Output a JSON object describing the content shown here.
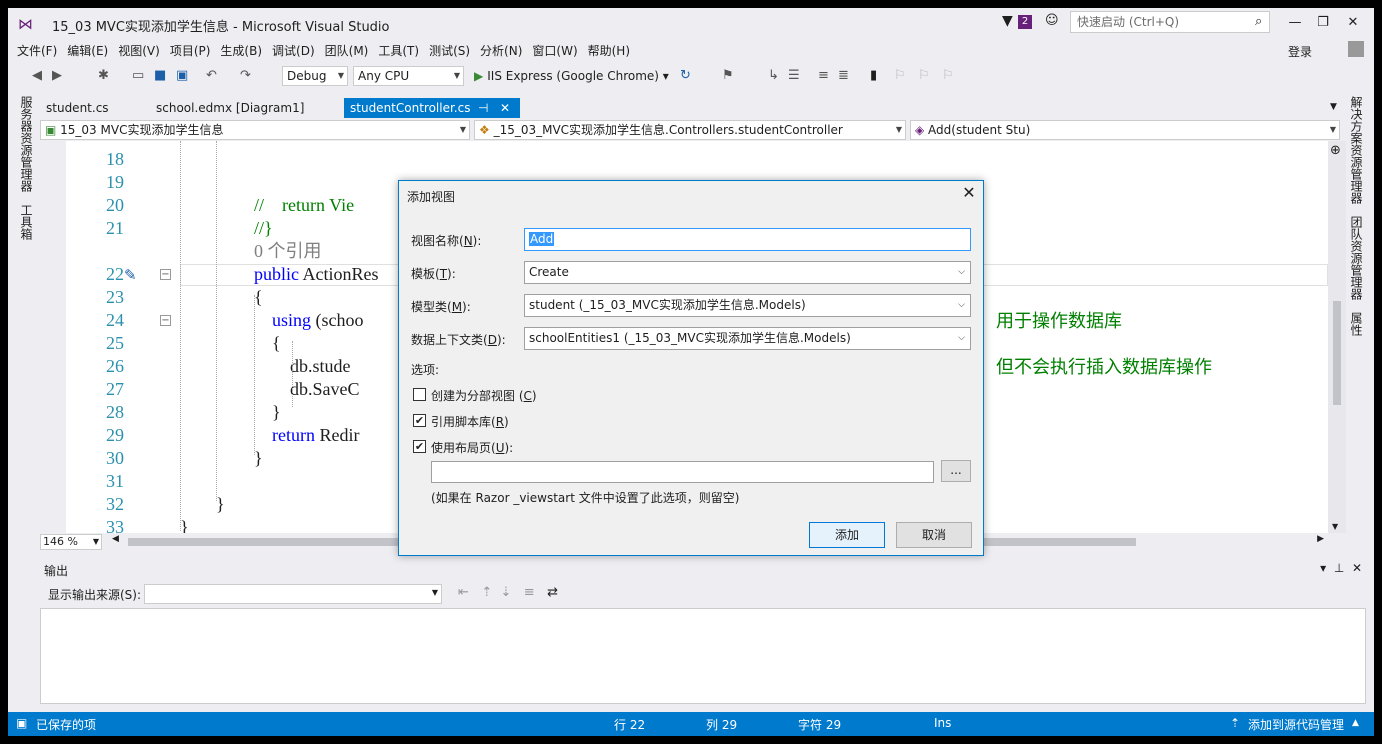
{
  "window": {
    "title": "15_03 MVC实现添加学生信息 - Microsoft Visual Studio",
    "notification_count": "2",
    "quick_launch_placeholder": "快速启动 (Ctrl+Q)",
    "login": "登录"
  },
  "menu": [
    "文件(F)",
    "编辑(E)",
    "视图(V)",
    "项目(P)",
    "生成(B)",
    "调试(D)",
    "团队(M)",
    "工具(T)",
    "测试(S)",
    "分析(N)",
    "窗口(W)",
    "帮助(H)"
  ],
  "toolbar": {
    "config": "Debug",
    "platform": "Any CPU",
    "run_target": "IIS Express (Google Chrome)"
  },
  "left_strip": [
    "服务器资源管理器",
    "工具箱"
  ],
  "right_strip": [
    "解决方案资源管理器",
    "团队资源管理器",
    "属性"
  ],
  "tabs": [
    {
      "label": "student.cs",
      "active": false
    },
    {
      "label": "school.edmx [Diagram1]",
      "active": false
    },
    {
      "label": "studentController.cs",
      "active": true
    }
  ],
  "navbar": {
    "project": "15_03 MVC实现添加学生信息",
    "class": "_15_03_MVC实现添加学生信息.Controllers.studentController",
    "member": "Add(student Stu)"
  },
  "editor": {
    "lines": [
      {
        "num": "18",
        "parts": []
      },
      {
        "num": "19",
        "parts": []
      },
      {
        "num": "20",
        "parts": [
          {
            "c": "cm",
            "t": "//    return Vie"
          }
        ]
      },
      {
        "num": "21",
        "parts": [
          {
            "c": "cm",
            "t": "//}"
          }
        ]
      },
      {
        "num": "",
        "parts": [
          {
            "c": "gy",
            "t": "0 个引用"
          }
        ]
      },
      {
        "num": "22",
        "parts": [
          {
            "c": "kw",
            "t": "public "
          },
          {
            "c": "tx",
            "t": "ActionRes"
          }
        ]
      },
      {
        "num": "23",
        "parts": [
          {
            "c": "tx",
            "t": "{"
          }
        ]
      },
      {
        "num": "24",
        "parts": [
          {
            "c": "kw",
            "t": "    using "
          },
          {
            "c": "tx",
            "t": "(schoo"
          }
        ]
      },
      {
        "num": "25",
        "parts": [
          {
            "c": "tx",
            "t": "    {"
          }
        ]
      },
      {
        "num": "26",
        "parts": [
          {
            "c": "tx",
            "t": "        db.stude"
          }
        ]
      },
      {
        "num": "27",
        "parts": [
          {
            "c": "tx",
            "t": "        db.SaveC"
          }
        ]
      },
      {
        "num": "28",
        "parts": [
          {
            "c": "tx",
            "t": "    }"
          }
        ]
      },
      {
        "num": "29",
        "parts": [
          {
            "c": "kw",
            "t": "    return "
          },
          {
            "c": "tx",
            "t": "Redir"
          }
        ]
      },
      {
        "num": "30",
        "parts": [
          {
            "c": "tx",
            "t": "}"
          }
        ]
      },
      {
        "num": "31",
        "parts": []
      },
      {
        "num": "32",
        "parts": [
          {
            "c": "tx",
            "t": "}"
          }
        ]
      },
      {
        "num": "33",
        "parts": [
          {
            "c": "tx",
            "t": "}"
          }
        ]
      }
    ],
    "right_comment_1": "用于操作数据库",
    "right_comment_2": "但不会执行插入数据库操作",
    "zoom": "146 %"
  },
  "output": {
    "title": "输出",
    "source_label": "显示输出来源(S):",
    "source_value": ""
  },
  "statusbar": {
    "message": "已保存的项",
    "line": "行 22",
    "col": "列 29",
    "char": "字符 29",
    "mode": "Ins",
    "source_control": "添加到源代码管理"
  },
  "dialog": {
    "title": "添加视图",
    "view_name_label": "视图名称(",
    "view_name_key": "N",
    "view_name_value": "Add",
    "template_label": "模板(",
    "template_key": "T",
    "template_value": "Create",
    "model_label": "模型类(",
    "model_key": "M",
    "model_value": "student (_15_03_MVC实现添加学生信息.Models)",
    "context_label": "数据上下文类(",
    "context_key": "D",
    "context_value": "schoolEntities1 (_15_03_MVC实现添加学生信息.Models)",
    "options_label": "选项:",
    "partial_label": "创建为分部视图 (",
    "partial_key": "C",
    "partial_checked": false,
    "scripts_label": "引用脚本库(",
    "scripts_key": "R",
    "scripts_checked": true,
    "layout_label": "使用布局页(",
    "layout_key": "U",
    "layout_checked": true,
    "layout_path": "",
    "browse": "...",
    "hint": "(如果在 Razor _viewstart 文件中设置了此选项，则留空)",
    "add_button": "添加",
    "cancel_button": "取消"
  },
  "colors": {
    "accent": "#007acc",
    "vs_purple": "#68217a",
    "keyword": "#0000ff",
    "comment": "#008000",
    "line_number": "#2b91af"
  }
}
